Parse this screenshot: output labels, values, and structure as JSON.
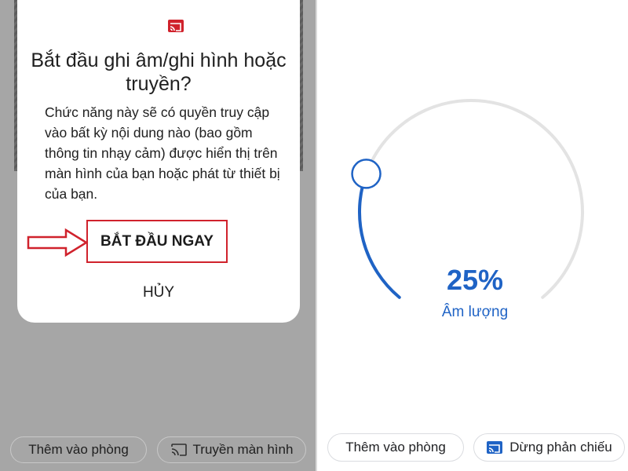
{
  "dialog": {
    "title": "Bắt đầu ghi âm/ghi hình hoặc truyền?",
    "body": "Chức năng này sẽ có quyền truy cập vào bất kỳ nội dung nào (bao gồm thông tin nhạy cảm) được hiển thị trên màn hình của bạn hoặc phát từ thiết bị của bạn.",
    "start_label": "BẮT ĐẦU NGAY",
    "cancel_label": "HỦY",
    "icon": "cast-icon"
  },
  "left_bottom": {
    "add_room_label": "Thêm vào phòng",
    "cast_screen_label": "Truyền màn hình"
  },
  "volume": {
    "percent_text": "25%",
    "label": "Âm lượng",
    "level": 0.25
  },
  "right_bottom": {
    "add_room_label": "Thêm vào phòng",
    "stop_mirroring_label": "Dừng phản chiếu"
  },
  "colors": {
    "accent_blue": "#1f63c5",
    "highlight_red": "#d0222c",
    "ring_gray": "#e3e3e3"
  }
}
